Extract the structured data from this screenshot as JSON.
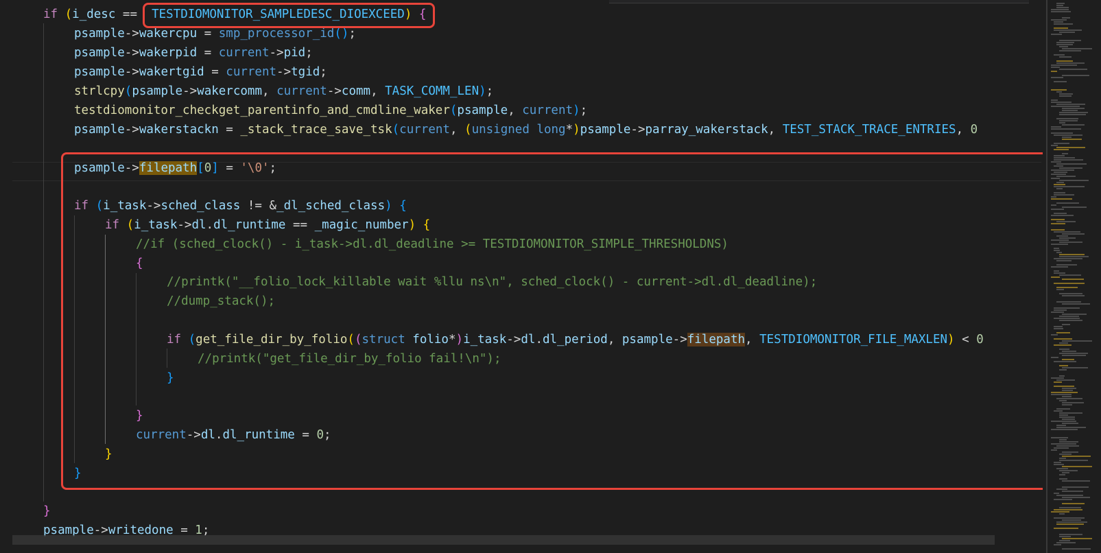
{
  "editor": {
    "code": {
      "l0": {
        "t1": "if",
        "t2": " (",
        "t3": "i_desc",
        "t4": " == ",
        "t5": " TESTDIOMONITOR_SAMPLEDESC_DIOEXCEED",
        "t6": ")",
        "t7": " {"
      },
      "l1": {
        "t1": "psample",
        "t2": "->",
        "t3": "wakercpu",
        "t4": " = ",
        "t5": "smp_processor_id",
        "t6": "()",
        "t7": ";"
      },
      "l2": {
        "t1": "psample",
        "t2": "->",
        "t3": "wakerpid",
        "t4": " = ",
        "t5": "current",
        "t6": "->",
        "t7": "pid",
        "t8": ";"
      },
      "l3": {
        "t1": "psample",
        "t2": "->",
        "t3": "wakertgid",
        "t4": " = ",
        "t5": "current",
        "t6": "->",
        "t7": "tgid",
        "t8": ";"
      },
      "l4": {
        "t1": "strlcpy",
        "t2": "(",
        "t3": "psample",
        "t4": "->",
        "t5": "wakercomm",
        "t6": ", ",
        "t7": "current",
        "t8": "->",
        "t9": "comm",
        "t10": ", ",
        "t11": "TASK_COMM_LEN",
        "t12": ")",
        "t13": ";"
      },
      "l5": {
        "t1": "testdiomonitor_checkget_parentinfo_and_cmdline_waker",
        "t2": "(",
        "t3": "psample",
        "t4": ", ",
        "t5": "current",
        "t6": ")",
        "t7": ";"
      },
      "l6": {
        "t1": "psample",
        "t2": "->",
        "t3": "wakerstackn",
        "t4": " = ",
        "t5": "_stack_trace_save_tsk",
        "t6": "(",
        "t7": "current",
        "t8": ", ",
        "t9": "(",
        "t10": "unsigned",
        "t11": " ",
        "t12": "long",
        "t13": "*",
        "t14": ")",
        "t15": "psample",
        "t16": "->",
        "t17": "parray_wakerstack",
        "t18": ", ",
        "t19": "TEST_STACK_TRACE_ENTRIES",
        "t20": ", ",
        "t21": "0"
      },
      "l8": {
        "t1": "psample",
        "t2": "->",
        "t3": "filepath",
        "t4": "[",
        "t5": "0",
        "t6": "]",
        "t7": " = ",
        "t8": "'\\0'",
        "t9": ";"
      },
      "l10": {
        "t1": "if",
        "t2": " (",
        "t3": "i_task",
        "t4": "->",
        "t5": "sched_class",
        "t6": " != ",
        "t7": "&",
        "t8": "_dl_sched_class",
        "t9": ")",
        "t10": " {"
      },
      "l11": {
        "t1": "if",
        "t2": " (",
        "t3": "i_task",
        "t4": "->",
        "t5": "dl",
        "t6": ".",
        "t7": "dl_runtime",
        "t8": " == ",
        "t9": "_magic_number",
        "t10": ")",
        "t11": " {"
      },
      "l12": {
        "t1": "//if (sched_clock() - i_task->dl.dl_deadline >= TESTDIOMONITOR_SIMPLE_THRESHOLDNS)"
      },
      "l13": {
        "t1": "{"
      },
      "l14": {
        "t1": "//printk(\"__folio_lock_killable wait %llu ns\\n\", sched_clock() - current->dl.dl_deadline);"
      },
      "l15": {
        "t1": "//dump_stack();"
      },
      "l17": {
        "t1": "if",
        "t2": " (",
        "t3": "get_file_dir_by_folio",
        "t4": "(",
        "t5": "(",
        "t6": "struct",
        "t7": " ",
        "t8": "folio",
        "t9": "*",
        "t10": ")",
        "t11": "i_task",
        "t12": "->",
        "t13": "dl",
        "t14": ".",
        "t15": "dl_period",
        "t16": ", ",
        "t17": "psample",
        "t18": "->",
        "t19": "filepath",
        "t20": ", ",
        "t21": "TESTDIOMONITOR_FILE_MAXLEN",
        "t22": ")",
        "t23": " < ",
        "t24": "0"
      },
      "l18": {
        "t1": "//printk(\"get_file_dir_by_folio fail!\\n\");"
      },
      "l19": {
        "t1": "}"
      },
      "l21": {
        "t1": "}"
      },
      "l22": {
        "t1": "current",
        "t2": "->",
        "t3": "dl",
        "t4": ".",
        "t5": "dl_runtime",
        "t6": " = ",
        "t7": "0",
        "t8": ";"
      },
      "l23": {
        "t1": "}"
      },
      "l24": {
        "t1": "}"
      },
      "l26": {
        "t1": "}"
      },
      "l27": {
        "t1": "psample",
        "t2": "->",
        "t3": "writedone",
        "t4": " = ",
        "t5": "1",
        "t6": ";"
      }
    }
  },
  "colors": {
    "background": "#1e1e1e",
    "annotation_box": "#e8443a",
    "keyword": "#c586c0",
    "type": "#569cd6",
    "constant": "#4fc1ff",
    "function": "#dcdcaa",
    "variable": "#9cdcfe",
    "comment": "#6a9955",
    "number": "#b5cea8",
    "string": "#ce9178"
  }
}
